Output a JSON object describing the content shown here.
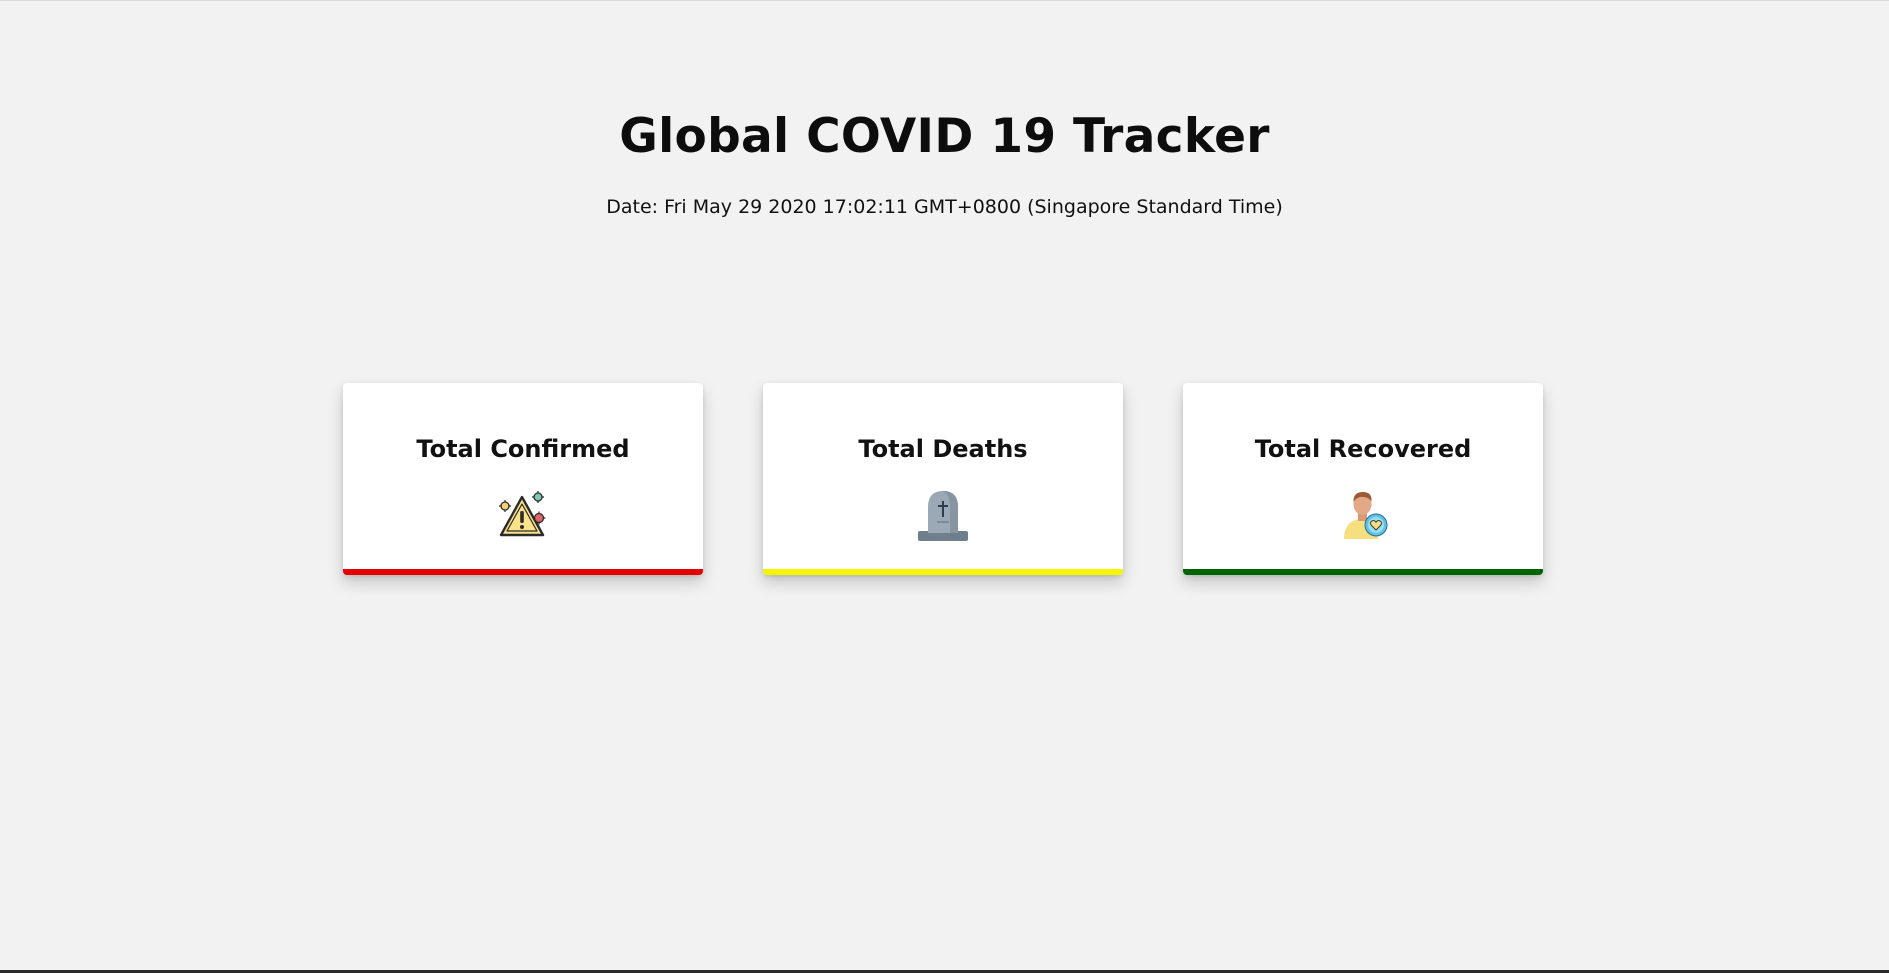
{
  "header": {
    "title": "Global COVID 19 Tracker",
    "date_text": "Date: Fri May 29 2020 17:02:11 GMT+0800 (Singapore Standard Time)"
  },
  "cards": [
    {
      "title": "Total Confirmed",
      "icon": "virus-warning-icon",
      "accent": "#e60000"
    },
    {
      "title": "Total Deaths",
      "icon": "tombstone-icon",
      "accent": "#f5f500"
    },
    {
      "title": "Total Recovered",
      "icon": "recovered-person-icon",
      "accent": "#006400"
    }
  ]
}
